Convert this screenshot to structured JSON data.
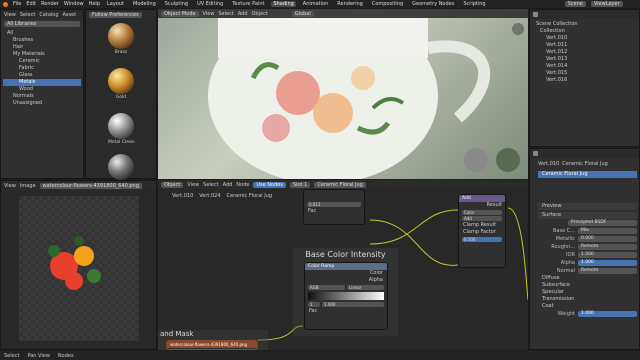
{
  "topbar": {
    "menus": [
      "File",
      "Edit",
      "Render",
      "Window",
      "Help"
    ],
    "workspaces": [
      "Layout",
      "Modeling",
      "Sculpting",
      "UV Editing",
      "Texture Paint",
      "Shading",
      "Animation",
      "Rendering",
      "Compositing",
      "Geometry Nodes",
      "Scripting"
    ],
    "active_workspace": "Shading",
    "scene": "Scene",
    "viewlayer": "ViewLayer"
  },
  "filebrowser": {
    "header": [
      "View",
      "Select",
      "Catalog",
      "Asset"
    ],
    "library": "Follow Preferences",
    "all_libraries": "All Libraries",
    "tree": [
      "All",
      "Brushes",
      "Hair",
      "My Materials",
      "Ceramic",
      "Fabric",
      "Glass",
      "Metals",
      "Wood",
      "Normals",
      "Unassigned"
    ],
    "selected_index": 7
  },
  "materials": [
    {
      "name": "Brass",
      "color": "#b07a3a"
    },
    {
      "name": "Gold",
      "color": "#c98a2a"
    },
    {
      "name": "Metal Clean",
      "color": "#9a9a9a"
    },
    {
      "name": "",
      "color": "#777777"
    }
  ],
  "viewport": {
    "header": [
      "View",
      "Select",
      "Add",
      "Object"
    ],
    "mode": "Object Mode",
    "orientation": "Global"
  },
  "outliner": {
    "title": "Scene Collection",
    "items": [
      "Collection",
      "Vert.010",
      "Vert.011",
      "Vert.012",
      "Vert.013",
      "Vert.014",
      "Vert.015",
      "Vert.016"
    ]
  },
  "image_editor": {
    "header": [
      "View",
      "View",
      "Image"
    ],
    "image_name": "watercolour-flowers-4391800_640.png"
  },
  "node_editor": {
    "header": [
      "Object",
      "View",
      "Select",
      "Add",
      "Node"
    ],
    "use_nodes": "Use Nodes",
    "slot": "Slot 1",
    "material": "Ceramic Floral Jug",
    "breadcrumb": [
      "Vert.010",
      "Vert.024",
      "Ceramic Floral Jug"
    ],
    "frame_title": "Base Color Intensity",
    "frame2_title": "and Mask",
    "colorramp": {
      "title": "Color Ramp",
      "out1": "Color",
      "out2": "Alpha",
      "mode": "RGB",
      "interp": "Linear",
      "index": "1",
      "pos_label": "Pos",
      "pos": "1.000",
      "fac": "Fac"
    },
    "top_node": {
      "index": "0",
      "pos_label": "Pos",
      "pos": "0.613",
      "fac": "Fac"
    },
    "mix_node": {
      "title": "Add",
      "result": "Result",
      "blend": "Color",
      "op": "Add",
      "clamp_result": "Clamp Result",
      "clamp_factor": "Clamp Factor",
      "factor_label": "Factor",
      "factor": "0.500",
      "a": "A",
      "b": "B"
    },
    "image_node": {
      "title": "watercolour-flowers-4391800_640.png",
      "color": "Color"
    }
  },
  "properties": {
    "object": "Vert.010",
    "material": "Ceramic Floral Jug",
    "slot": "Ceramic Floral Jug",
    "sections": {
      "preview": "Preview",
      "surface": "Surface"
    },
    "surface": "Principled BSDF",
    "rows": [
      {
        "label": "Base C...",
        "value": "Mix"
      },
      {
        "label": "Metallic",
        "value": "0.000"
      },
      {
        "label": "Roughn...",
        "value": "Remote"
      },
      {
        "label": "IOR",
        "value": "1.500"
      },
      {
        "label": "Alpha",
        "value": "1.000"
      },
      {
        "label": "Normal",
        "value": "Remote"
      }
    ],
    "subsections": [
      "Diffuse",
      "Subsurface",
      "Specular",
      "Transmission",
      "Coat"
    ],
    "weight_label": "Weight",
    "weight": "1.000"
  },
  "statusbar": [
    "Select",
    "Pan View",
    "Nodes"
  ]
}
